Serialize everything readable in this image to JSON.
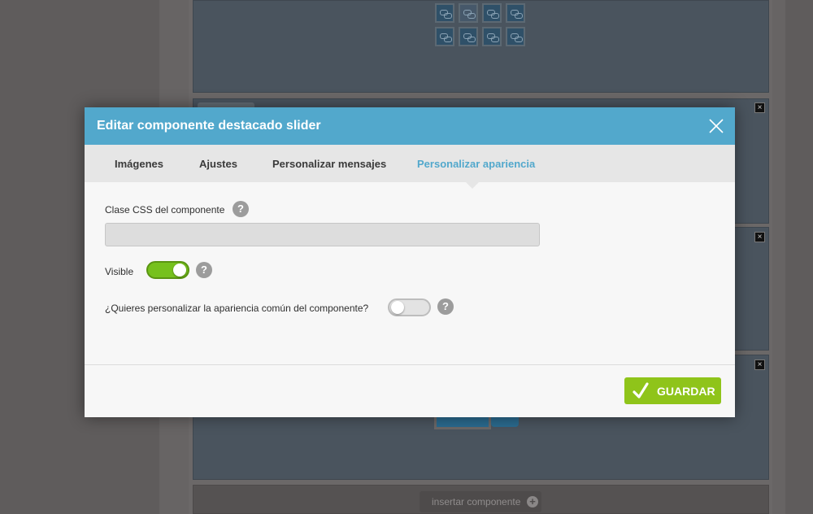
{
  "background": {
    "insert_component_label": "insertar componente",
    "insert_icon": "plus-circle-icon",
    "close_glyph": "×"
  },
  "modal": {
    "title": "Editar componente destacado slider",
    "close_icon": "close-icon",
    "tabs": [
      {
        "label": "Imágenes",
        "active": false
      },
      {
        "label": "Ajustes",
        "active": false
      },
      {
        "label": "Personalizar mensajes",
        "active": false
      },
      {
        "label": "Personalizar apariencia",
        "active": true
      }
    ],
    "css_class": {
      "label": "Clase CSS del componente",
      "value": "",
      "placeholder": ""
    },
    "visible": {
      "label": "Visible",
      "on": true
    },
    "custom_appearance": {
      "label": "¿Quieres personalizar la apariencia común del componente?",
      "on": false
    },
    "help_glyph": "?",
    "save_label": "GUARDAR"
  },
  "colors": {
    "header": "#52a8cc",
    "active_tab": "#52a8cc",
    "toggle_on": "#76c11d",
    "save_button": "#8fc41a",
    "overlay": "#5f5c5c"
  }
}
